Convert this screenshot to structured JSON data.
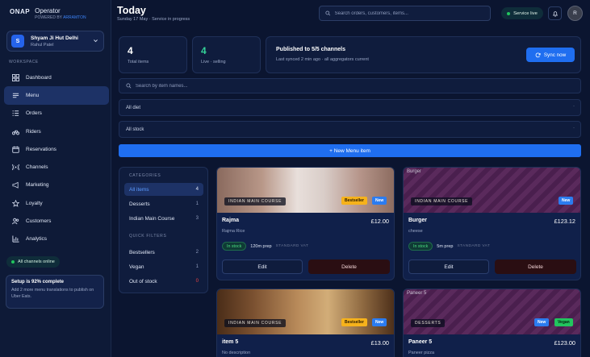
{
  "brand": {
    "logo": "ONAP",
    "title": "Operator",
    "powered_prefix": "POWERED BY",
    "powered_name": "ARRAMTON"
  },
  "store": {
    "initial": "S",
    "name": "Shyam Ji Hut Delhi",
    "owner": "Rahul Patel"
  },
  "sidebar": {
    "workspace_label": "WORKSPACE",
    "items": [
      {
        "label": "Dashboard",
        "icon": "dashboard-icon",
        "active": false
      },
      {
        "label": "Menu",
        "icon": "menu-icon",
        "active": true
      },
      {
        "label": "Orders",
        "icon": "orders-icon",
        "active": false
      },
      {
        "label": "Riders",
        "icon": "bike-icon",
        "active": false
      },
      {
        "label": "Reservations",
        "icon": "calendar-icon",
        "active": false
      },
      {
        "label": "Channels",
        "icon": "broadcast-icon",
        "active": false
      },
      {
        "label": "Marketing",
        "icon": "megaphone-icon",
        "active": false
      },
      {
        "label": "Loyalty",
        "icon": "star-icon",
        "active": false
      },
      {
        "label": "Customers",
        "icon": "users-icon",
        "active": false
      },
      {
        "label": "Analytics",
        "icon": "chart-icon",
        "active": false
      }
    ],
    "online_label": "All channels online",
    "setup_title": "Setup is 92% complete",
    "setup_text": "Add 2 more menu translations to publish on Uber Eats."
  },
  "header": {
    "title": "Today",
    "subtitle": "Sunday 17 May · Service in progress",
    "search_placeholder": "Search orders, customers, items...",
    "service_label": "Service live",
    "user_initial": "R"
  },
  "stats": {
    "total_value": "4",
    "total_label": "Total items",
    "live_value": "4",
    "live_label": "Live · selling",
    "published_title": "Published to 5/5 channels",
    "published_sub": "Last synced 2 min ago · all aggregators current",
    "sync_label": "Sync now"
  },
  "filters": {
    "search_placeholder": "Search by item names...",
    "diet_value": "All diet",
    "stock_value": "All stock",
    "new_button": "+ New Menu item"
  },
  "categories": {
    "heading": "CATEGORIES",
    "items": [
      {
        "label": "All items",
        "count": "4"
      },
      {
        "label": "Desserts",
        "count": "1"
      },
      {
        "label": "Indian Main Course",
        "count": "3"
      }
    ],
    "quick_heading": "QUICK FILTERS",
    "quick": [
      {
        "label": "Bestsellers",
        "count": "2"
      },
      {
        "label": "Vegan",
        "count": "1"
      },
      {
        "label": "Out of stock",
        "count": "0"
      }
    ]
  },
  "menu_items": [
    {
      "name": "Rajma",
      "price": "£12.00",
      "desc": "Rajma Rice",
      "cuisine": "INDIAN MAIN COURSE",
      "badge1": "Bestseller",
      "badge2": "New",
      "stock": "In stock",
      "prep": "120m prep",
      "vat": "STANDARD VAT",
      "alt": ""
    },
    {
      "name": "Burger",
      "price": "£123.12",
      "desc": "cheese",
      "cuisine": "INDIAN MAIN COURSE",
      "badge1": "",
      "badge2": "New",
      "stock": "In stock",
      "prep": "5m prep",
      "vat": "STANDARD VAT",
      "alt": "Burger"
    },
    {
      "name": "item 5",
      "price": "£13.00",
      "desc": "No description",
      "cuisine": "INDIAN MAIN COURSE",
      "badge1": "Bestseller",
      "badge2": "New",
      "alt": ""
    },
    {
      "name": "Paneer 5",
      "price": "£123.00",
      "desc": "Paneer pizza",
      "cuisine": "DESSERTS",
      "badge1": "New",
      "badge2": "Vegan",
      "alt": "Paneer 5"
    }
  ],
  "actions": {
    "edit": "Edit",
    "delete": "Delete"
  }
}
